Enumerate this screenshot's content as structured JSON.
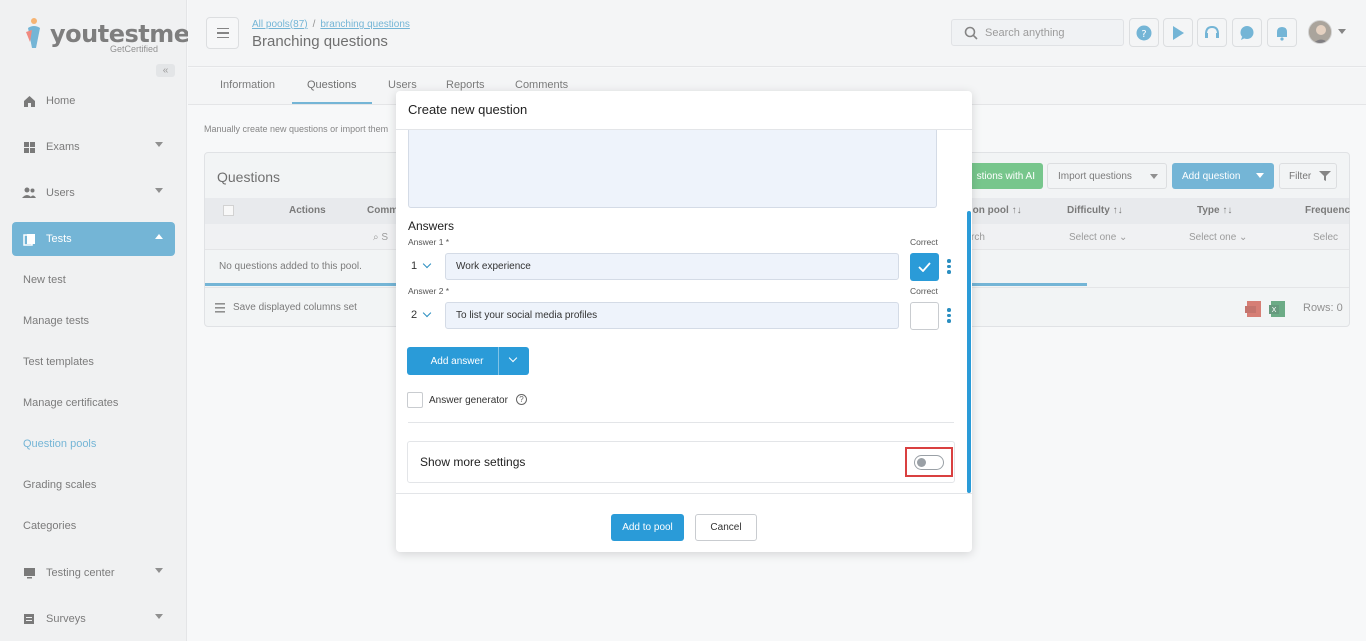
{
  "app": {
    "brand": "youtestme",
    "brand_sub": "GetCertified"
  },
  "sidebar": {
    "items": [
      {
        "label": "Home",
        "icon": "home-icon"
      },
      {
        "label": "Exams",
        "icon": "exams-icon"
      },
      {
        "label": "Users",
        "icon": "users-icon"
      },
      {
        "label": "Tests",
        "icon": "tests-icon"
      },
      {
        "label": "Testing center",
        "icon": "testing-center-icon"
      },
      {
        "label": "Surveys",
        "icon": "surveys-icon"
      }
    ],
    "sub_items": [
      "New test",
      "Manage tests",
      "Test templates",
      "Manage certificates",
      "Question pools",
      "Grading scales",
      "Categories"
    ]
  },
  "header": {
    "breadcrumb_1": "All pools(87)",
    "breadcrumb_sep": "/",
    "breadcrumb_2": "branching questions",
    "title": "Branching questions",
    "search_placeholder": "Search anything"
  },
  "tabs": [
    "Information",
    "Questions",
    "Users",
    "Reports",
    "Comments"
  ],
  "main": {
    "hint": "Manually create new questions or import them",
    "panel_title": "Questions",
    "ai_button": "stions with AI",
    "import_button": "Import questions",
    "add_button": "Add question",
    "filter_button": "Filter",
    "columns": [
      "Actions",
      "Comm",
      "stion pool",
      "Difficulty",
      "Type",
      "Frequenc"
    ],
    "filter_row": [
      "S",
      "rch",
      "Select one",
      "Select one",
      "Selec"
    ],
    "empty": "No questions added to this pool.",
    "save_columns": "Save displayed columns set",
    "rows": "Rows: 0"
  },
  "modal": {
    "title": "Create new question",
    "answers_heading": "Answers",
    "answers": [
      {
        "label": "Answer 1 *",
        "number": "1",
        "value": "Work experience",
        "correct": true
      },
      {
        "label": "Answer 2 *",
        "number": "2",
        "value": "To list your social media profiles",
        "correct": false
      }
    ],
    "correct_label": "Correct",
    "add_answer": "Add answer",
    "answer_generator": "Answer generator",
    "show_more": "Show more settings",
    "show_more_on": false,
    "add_to_pool": "Add to pool",
    "cancel": "Cancel"
  },
  "colors": {
    "accent": "#2a8ec0",
    "ai_green": "#2fa84f",
    "highlight_red": "#d94040"
  }
}
